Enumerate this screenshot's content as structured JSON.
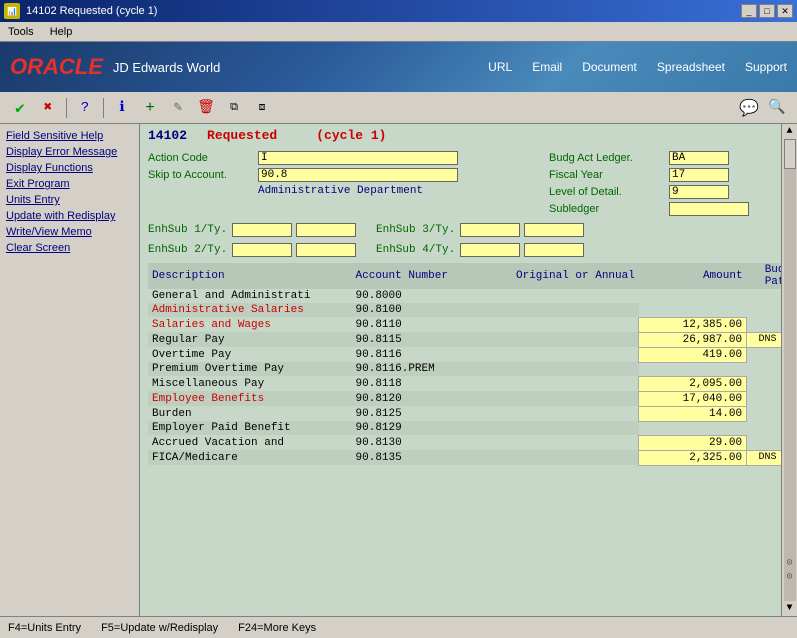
{
  "titlebar": {
    "title": "14102   Requested   (cycle 1)",
    "icon": "★"
  },
  "menubar": {
    "items": [
      "Tools",
      "Help"
    ]
  },
  "nav": {
    "url": "URL",
    "email": "Email",
    "document": "Document",
    "spreadsheet": "Spreadsheet",
    "support": "Support"
  },
  "oracle": {
    "name": "ORACLE",
    "jde": "JD Edwards World"
  },
  "sidebar": {
    "items": [
      "Field Sensitive Help",
      "Display Error Message",
      "Display Functions",
      "Exit Program",
      "Units Entry",
      "Update with Redisplay",
      "Write/View Memo",
      "Clear Screen"
    ]
  },
  "form": {
    "number": "14102",
    "status": "Requested",
    "cycle": "(cycle 1)",
    "action_code_label": "Action Code",
    "action_code_value": "I",
    "skip_to_label": "Skip to Account.",
    "skip_to_value": "90.8",
    "dept_label": "Administrative Department",
    "budg_act_label": "Budg Act Ledger.",
    "budg_act_value": "BA",
    "fiscal_year_label": "Fiscal Year",
    "fiscal_year_value": "17",
    "level_detail_label": "Level of Detail.",
    "level_detail_value": "9",
    "subledger_label": "Subledger",
    "enhsub1_label": "EnhSub 1/Ty.",
    "enhsub2_label": "EnhSub 2/Ty.",
    "enhsub3_label": "EnhSub 3/Ty.",
    "enhsub4_label": "EnhSub 4/Ty."
  },
  "table": {
    "headers": {
      "description": "Description",
      "account_number": "Account Number",
      "original_annual": "Original or Annual",
      "amount": "Amount",
      "bud_pat": "Bud\nPat"
    },
    "rows": [
      {
        "desc": "General and Administrati",
        "acct": "90.8000",
        "amount": "",
        "dns": "",
        "style": "normal"
      },
      {
        "desc": "Administrative Salaries",
        "acct": "90.8100",
        "amount": "",
        "dns": "",
        "style": "red"
      },
      {
        "desc": "Salaries and Wages",
        "acct": "90.8110",
        "amount": "12,385.00",
        "dns": "",
        "style": "red"
      },
      {
        "desc": "Regular Pay",
        "acct": "90.8115",
        "amount": "26,987.00",
        "dns": "DNS",
        "style": "normal"
      },
      {
        "desc": "Overtime Pay",
        "acct": "90.8116",
        "amount": "419.00",
        "dns": "",
        "style": "normal"
      },
      {
        "desc": "Premium Overtime Pay",
        "acct": "90.8116.PREM",
        "amount": "",
        "dns": "",
        "style": "normal"
      },
      {
        "desc": "Miscellaneous Pay",
        "acct": "90.8118",
        "amount": "2,095.00",
        "dns": "",
        "style": "normal"
      },
      {
        "desc": "Employee Benefits",
        "acct": "90.8120",
        "amount": "17,040.00",
        "dns": "",
        "style": "red"
      },
      {
        "desc": "Burden",
        "acct": "90.8125",
        "amount": "14.00",
        "dns": "",
        "style": "normal"
      },
      {
        "desc": "Employer Paid Benefit",
        "acct": "90.8129",
        "amount": "",
        "dns": "",
        "style": "normal"
      },
      {
        "desc": "Accrued Vacation and",
        "acct": "90.8130",
        "amount": "29.00",
        "dns": "",
        "style": "normal"
      },
      {
        "desc": "FICA/Medicare",
        "acct": "90.8135",
        "amount": "2,325.00",
        "dns": "DNS",
        "style": "normal"
      }
    ]
  },
  "statusbar": {
    "f4": "F4=Units Entry",
    "f5": "F5=Update w/Redisplay",
    "f24": "F24=More Keys"
  }
}
